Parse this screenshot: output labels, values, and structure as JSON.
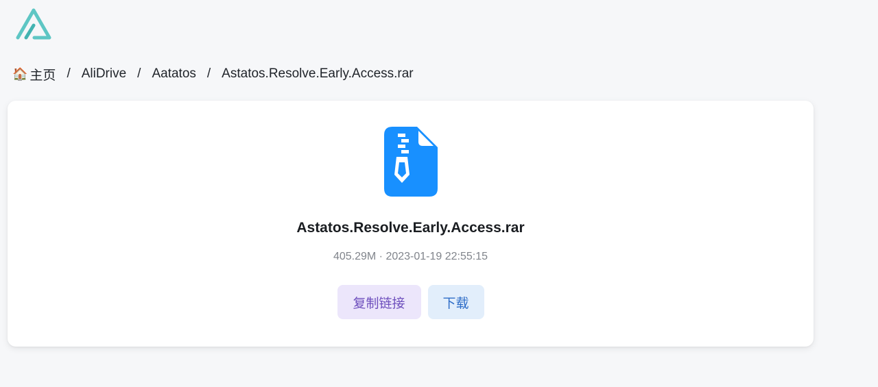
{
  "logo": {
    "icon": "alist-logo-icon",
    "colors": [
      "#5ec6c4",
      "#3aa6a5"
    ]
  },
  "breadcrumb": {
    "home_icon": "house-emoji",
    "items": [
      "主页",
      "AliDrive",
      "Aatatos",
      "Astatos.Resolve.Early.Access.rar"
    ],
    "separator": "/"
  },
  "file": {
    "icon": "zip-file-icon",
    "icon_color": "#1890ff",
    "name": "Astatos.Resolve.Early.Access.rar",
    "meta": "405.29M · 2023-01-19 22:55:15"
  },
  "actions": {
    "copy_link_label": "复制链接",
    "download_label": "下载"
  }
}
